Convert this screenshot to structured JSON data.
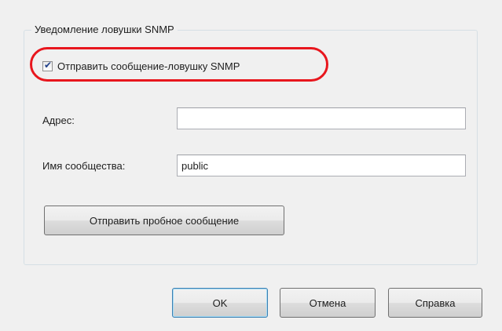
{
  "group": {
    "title": "Уведомление ловушки SNMP"
  },
  "send_trap": {
    "checked": true,
    "label": "Отправить сообщение-ловушку SNMP"
  },
  "address": {
    "label": "Адрес:",
    "value": ""
  },
  "community": {
    "label": "Имя сообщества:",
    "value": "public"
  },
  "test_button": {
    "label": "Отправить пробное сообщение"
  },
  "footer": {
    "ok_label": "OK",
    "cancel_label": "Отмена",
    "help_label": "Справка"
  },
  "colors": {
    "highlight_ring": "#e8161d",
    "check_mark": "#21418a"
  }
}
